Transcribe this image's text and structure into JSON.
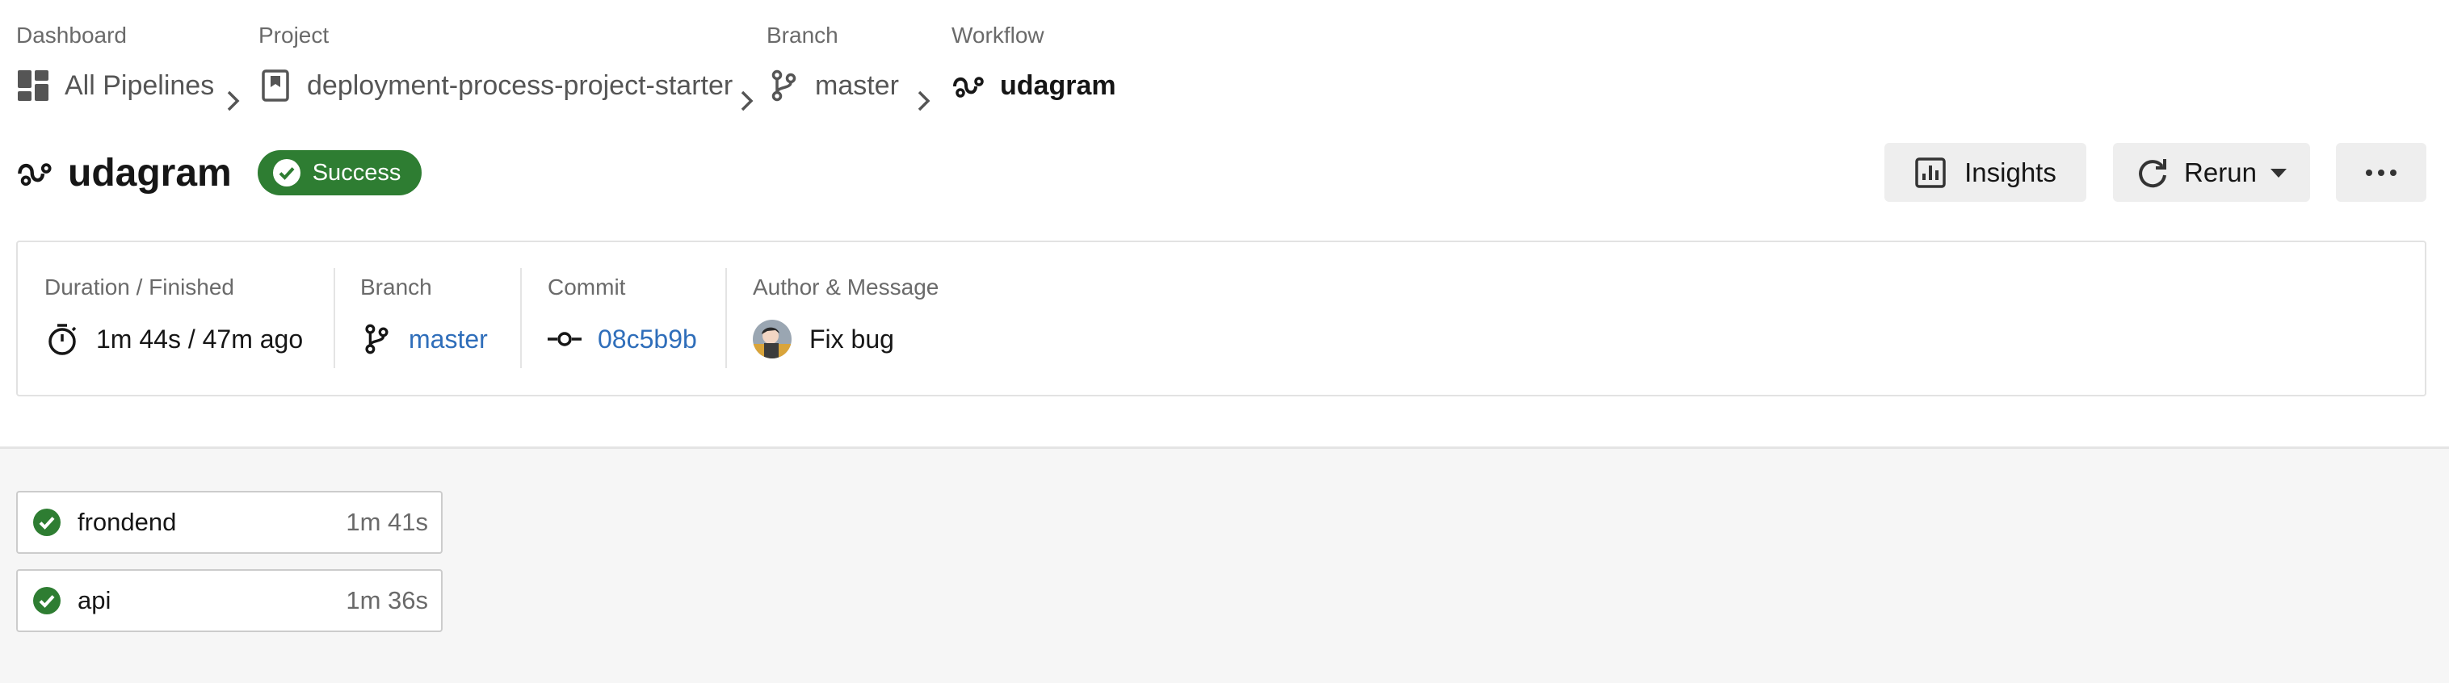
{
  "breadcrumbs": {
    "dashboard": {
      "label": "Dashboard",
      "value": "All Pipelines"
    },
    "project": {
      "label": "Project",
      "value": "deployment-process-project-starter"
    },
    "branch": {
      "label": "Branch",
      "value": "master"
    },
    "workflow": {
      "label": "Workflow",
      "value": "udagram"
    }
  },
  "header": {
    "title": "udagram",
    "status": "Success",
    "status_color": "#2e7d32",
    "insights_label": "Insights",
    "rerun_label": "Rerun"
  },
  "summary": {
    "duration": {
      "label": "Duration / Finished",
      "value": "1m 44s / 47m ago"
    },
    "branch": {
      "label": "Branch",
      "value": "master"
    },
    "commit": {
      "label": "Commit",
      "value": "08c5b9b"
    },
    "author": {
      "label": "Author & Message",
      "message": "Fix bug"
    }
  },
  "jobs": [
    {
      "name": "frondend",
      "duration": "1m 41s",
      "status": "success"
    },
    {
      "name": "api",
      "duration": "1m 36s",
      "status": "success"
    }
  ],
  "colors": {
    "link": "#2f6eba",
    "success": "#2e7d32"
  },
  "icons": [
    "dashboard-icon",
    "project-icon",
    "branch-icon",
    "workflow-icon",
    "chevron-right-icon",
    "check-circle-icon",
    "insights-icon",
    "rerun-icon",
    "caret-down-icon",
    "more-icon",
    "timer-icon",
    "commit-icon",
    "avatar"
  ]
}
